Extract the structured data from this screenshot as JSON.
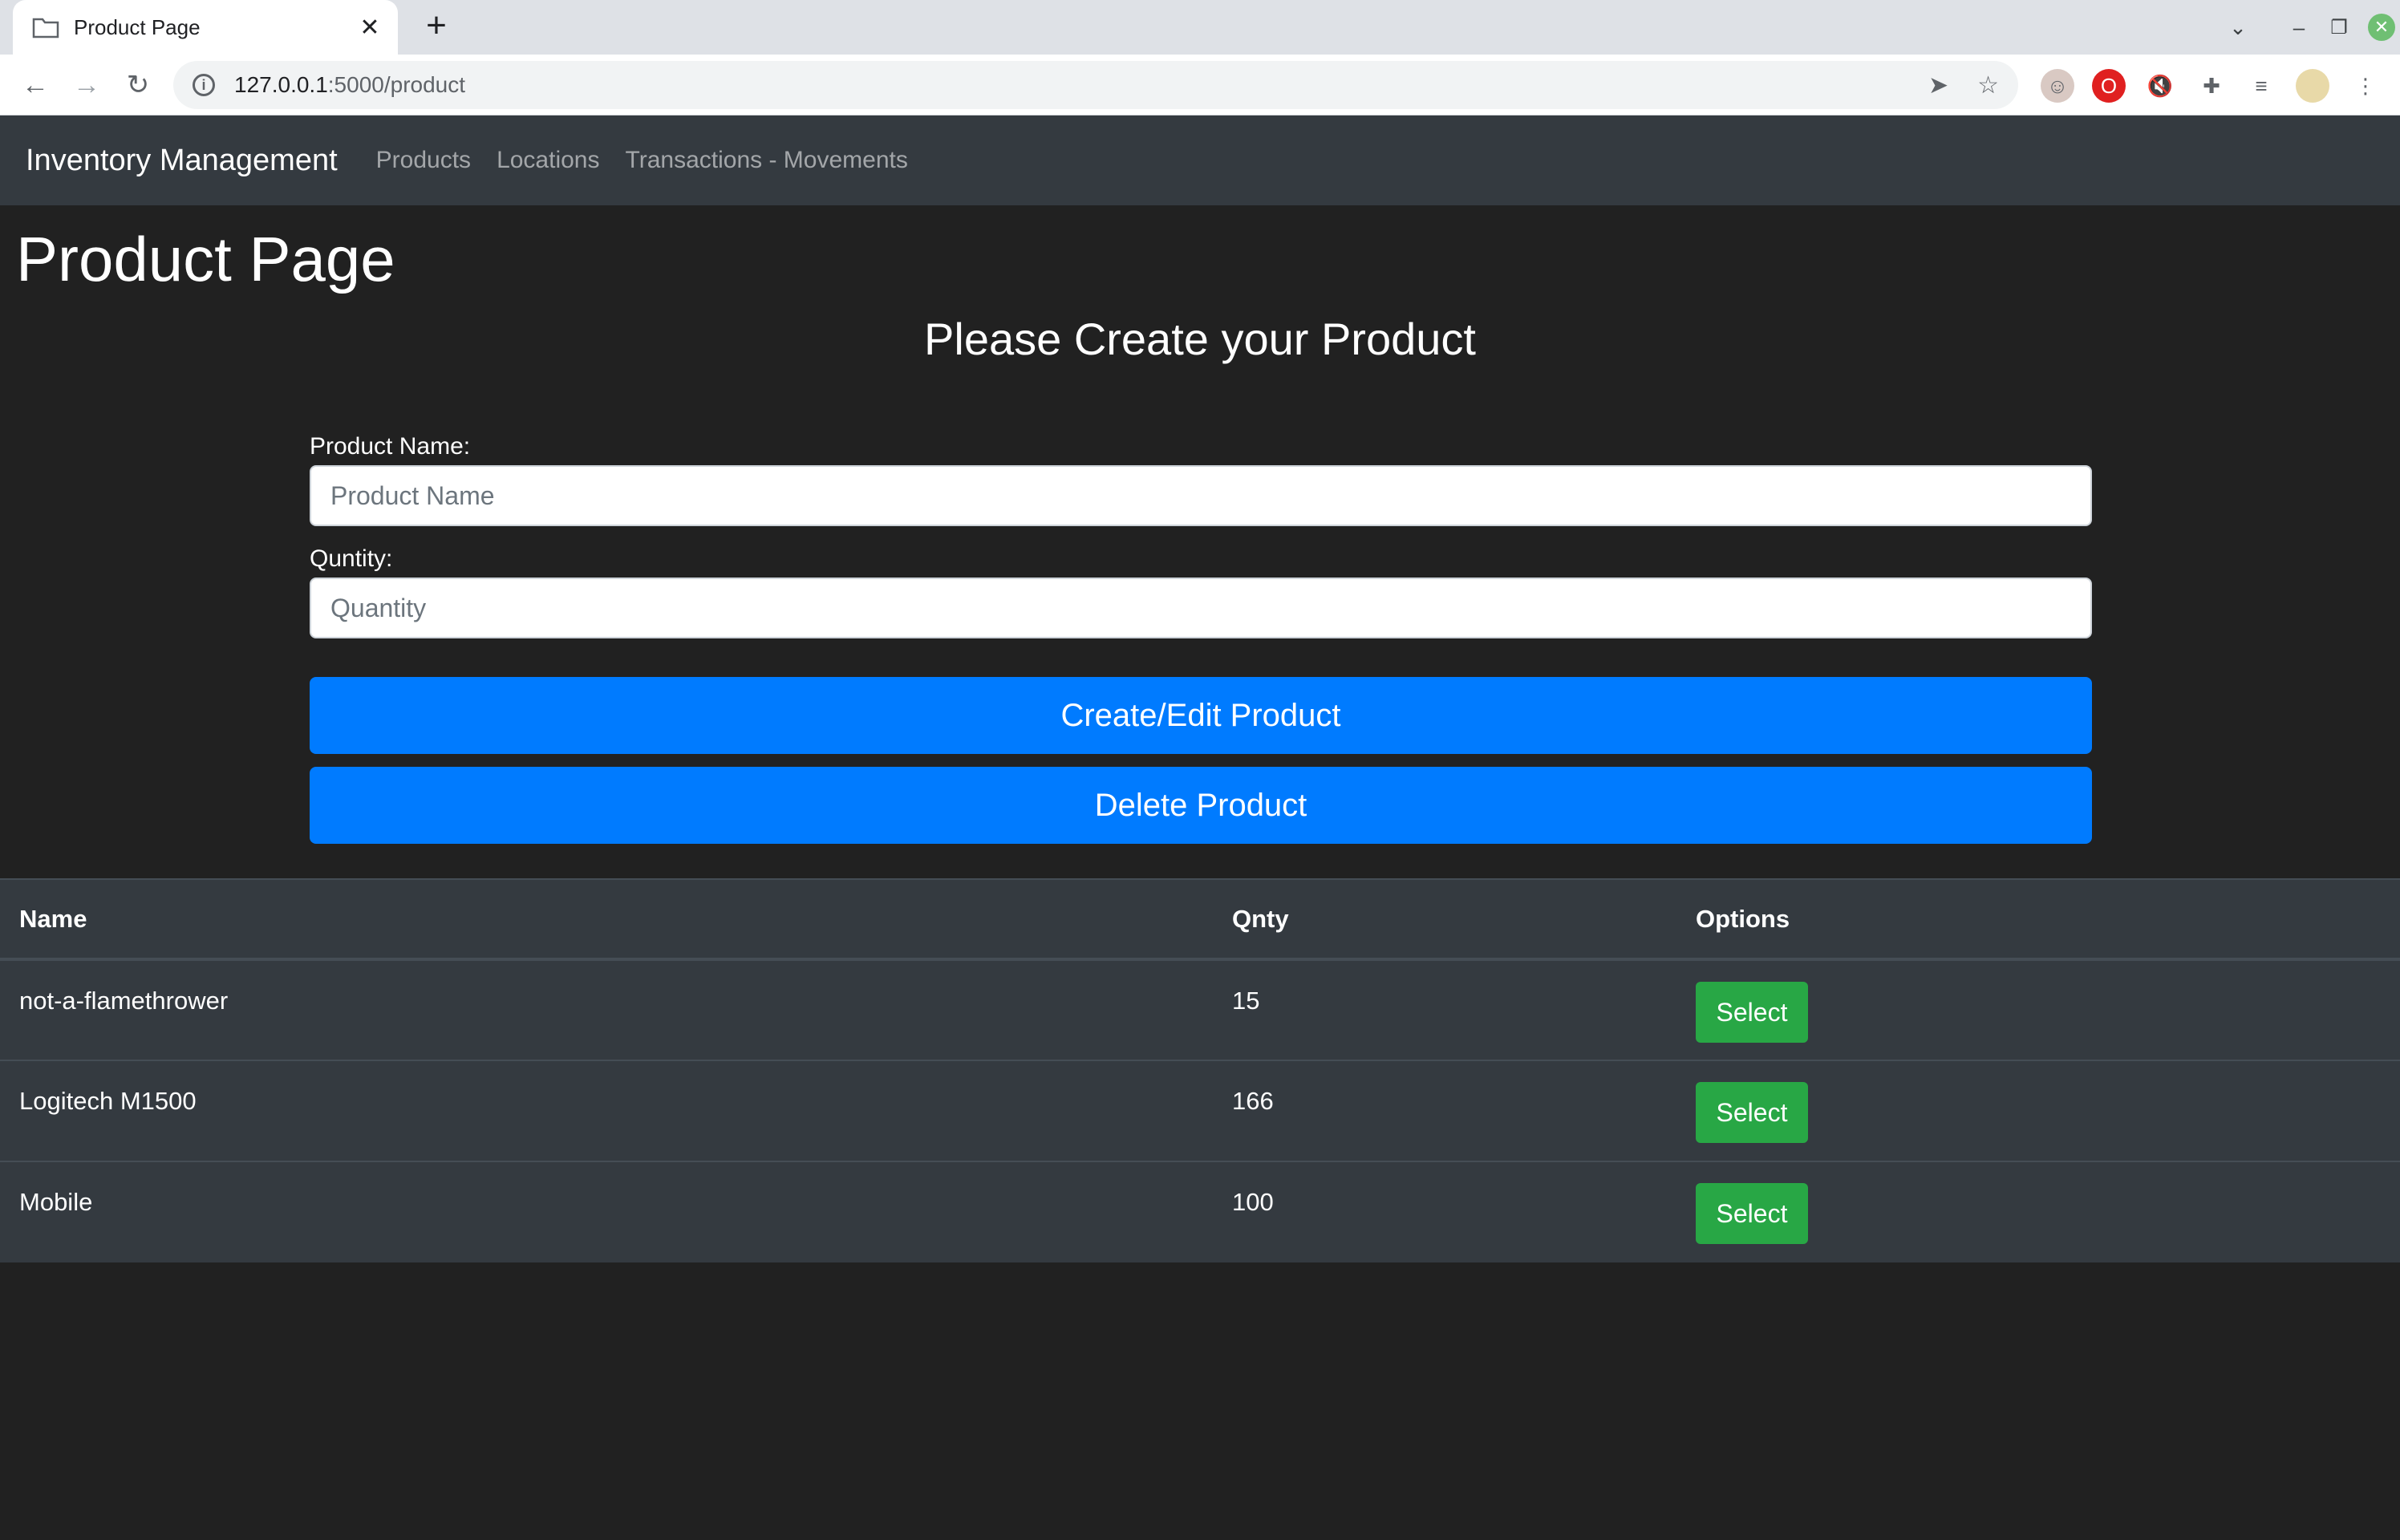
{
  "browser": {
    "tab_title": "Product Page",
    "new_tab_label": "+",
    "url_host": "127.0.0.1",
    "url_path": ":5000/product"
  },
  "navbar": {
    "brand": "Inventory Management",
    "links": [
      "Products",
      "Locations",
      "Transactions - Movements"
    ]
  },
  "page": {
    "title": "Product Page",
    "subtitle": "Please Create your Product"
  },
  "form": {
    "name_label": "Product Name:",
    "name_placeholder": "Product Name",
    "qty_label": "Quntity:",
    "qty_placeholder": "Quantity",
    "create_button": "Create/Edit Product",
    "delete_button": "Delete Product"
  },
  "table": {
    "headers": [
      "Name",
      "Qnty",
      "Options"
    ],
    "rows": [
      {
        "name": "not-a-flamethrower",
        "qty": "15",
        "action": "Select"
      },
      {
        "name": "Logitech M1500",
        "qty": "166",
        "action": "Select"
      },
      {
        "name": "Mobile",
        "qty": "100",
        "action": "Select"
      }
    ]
  },
  "colors": {
    "page_bg": "#212121",
    "navbar_bg": "#343a40",
    "primary": "#007bff",
    "success": "#28a745"
  }
}
